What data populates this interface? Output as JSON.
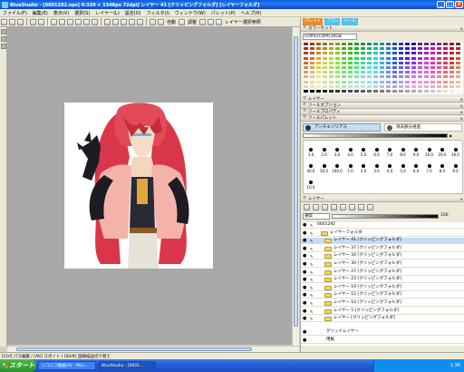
{
  "window": {
    "title": "BlueStudio - [0601292.xps] 0:339 × 1348px 72dpi] レイヤー 41 [クリッピングフォルダ] [レイヤーフォルダ]"
  },
  "menu": [
    "ファイル(F)",
    "編集(E)",
    "表示(V)",
    "選択(S)",
    "レイヤー(L)",
    "設定(O)",
    "フィルタ(I)",
    "ウィンドウ(W)",
    "パレット(P)",
    "ヘルプ(H)"
  ],
  "toolbar": {
    "auto_label": "自動",
    "adjust_label": "調整",
    "ref_label": "レイヤー選択参照"
  },
  "status": {
    "left": "[Ctrl] パス編集 / [Alt] スポイト / [Shift] 直線描画切り替え"
  },
  "panels": {
    "top_right_badges": [
      "パレット",
      "ブラシ",
      "ツール"
    ],
    "color_set_label": "カラーセット",
    "color_set_name": "COPIC(COPIC)RGB",
    "subpanels": [
      "レイヤー",
      "ツールオプション",
      "ツールプロパティ",
      "ツールパレット"
    ],
    "brush_name": "アンチエイリアス",
    "brush_name2": "消去部分透過",
    "brush_sizes_row1": [
      "1.0",
      "2.0",
      "3.0",
      "4.0",
      "5.0",
      "6.0",
      "7.0",
      "8.0",
      "9.0",
      "10.0",
      "20.0",
      "30.0"
    ],
    "brush_sizes_row2": [
      "40.0",
      "50.0",
      "100.0",
      "1.0",
      "2.0",
      "3.0",
      "4.0",
      "5.0",
      "6.0",
      "7.0",
      "8.0",
      "9.0"
    ],
    "brush_sizes_row3": [
      "10.0"
    ],
    "layers_title": "レイヤー",
    "blend_mode": "通常",
    "opacity": "100"
  },
  "layers": [
    {
      "name": "0601292",
      "kind": "root"
    },
    {
      "name": "レイヤーフォルダ",
      "kind": "folder"
    },
    {
      "name": "レイヤー 41 [クリッピングフォルダ]",
      "kind": "clip",
      "selected": true
    },
    {
      "name": "レイヤー 37 [クリッピングフォルダ]",
      "kind": "clip"
    },
    {
      "name": "レイヤー 34 [クリッピングフォルダ]",
      "kind": "clip"
    },
    {
      "name": "レイヤー 30 [クリッピングフォルダ]",
      "kind": "clip"
    },
    {
      "name": "レイヤー 27 [クリッピングフォルダ]",
      "kind": "clip"
    },
    {
      "name": "レイヤー 23 [クリッピングフォルダ]",
      "kind": "clip"
    },
    {
      "name": "レイヤー 19 [クリッピングフォルダ]",
      "kind": "clip"
    },
    {
      "name": "レイヤー 15 [クリッピングフォルダ]",
      "kind": "clip"
    },
    {
      "name": "レイヤー 10 [クリッピングフォルダ]",
      "kind": "clip"
    },
    {
      "name": "レイヤー 5 [クリッピングフォルダ]",
      "kind": "clip"
    },
    {
      "name": "レイヤー [クリッピングフォルダ]",
      "kind": "clip"
    }
  ],
  "bottom_layers": [
    {
      "name": "グリッドレイヤー"
    },
    {
      "name": "用紙"
    }
  ],
  "taskbar": {
    "start": "スタート",
    "tasks": [
      "ニコニコ動画(9) - Micr...",
      "BlueStudio - [0601..."
    ],
    "clock": "1:36"
  },
  "colors": {
    "hair": "#d9364a",
    "accent": "#245edb"
  }
}
